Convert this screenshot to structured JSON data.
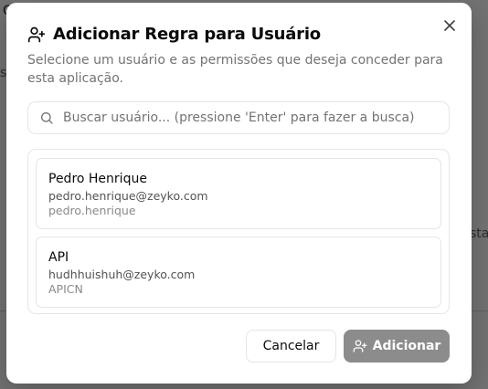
{
  "background": {
    "fragments": [
      "C",
      "s",
      "sta"
    ]
  },
  "dialog": {
    "title": "Adicionar Regra para Usuário",
    "subtitle": "Selecione um usuário e as permissões que deseja conceder para esta aplicação.",
    "title_icon": "user-plus-icon",
    "close_icon": "close-icon",
    "search": {
      "placeholder": "Buscar usuário... (pressione 'Enter' para fazer a busca)",
      "value": "",
      "icon": "search-icon"
    },
    "users": [
      {
        "name": "Pedro Henrique",
        "email": "pedro.henrique@zeyko.com",
        "username": "pedro.henrique"
      },
      {
        "name": "API",
        "email": "hudhhuishuh@zeyko.com",
        "username": "APICN"
      }
    ],
    "buttons": {
      "cancel_label": "Cancelar",
      "add_label": "Adicionar",
      "add_icon": "user-plus-icon"
    }
  },
  "colors": {
    "primary_disabled": "#8c8c8c",
    "border": "#e5e5e5",
    "muted_text": "#737373"
  }
}
